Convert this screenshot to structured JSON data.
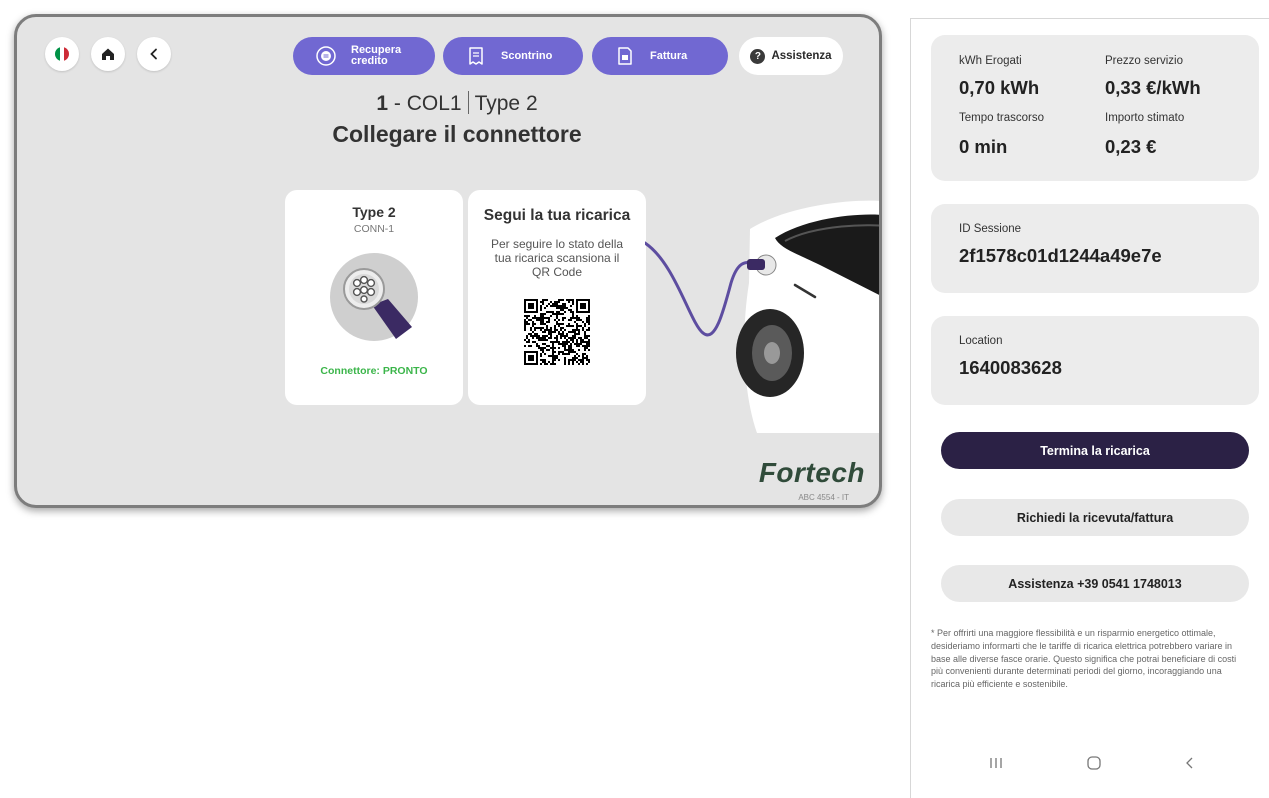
{
  "kiosk": {
    "toolbar": {
      "language_flag_colors": [
        "#009246",
        "#ffffff",
        "#ce2b37"
      ],
      "recover_credit_label": "Recupera\ncredito",
      "receipt_label": "Scontrino",
      "invoice_label": "Fattura",
      "help_label": "Assistenza",
      "help_glyph": "?",
      "accent_color": "#7168d2"
    },
    "station": {
      "number": "1",
      "name_prefix": " - COL1",
      "connector_type": "Type 2"
    },
    "instruction": "Collegare il connettore",
    "connector_card": {
      "title": "Type 2",
      "code": "CONN-1",
      "status": "Connettore: PRONTO",
      "status_color": "#3bb54a"
    },
    "qr_card": {
      "title": "Segui la tua ricarica",
      "text": "Per seguire lo stato della tua ricarica scansiona il QR Code"
    },
    "brand": "Fortech",
    "serial": "ABC 4554 - IT"
  },
  "phone": {
    "stats": {
      "kwh_label": "kWh Erogati",
      "kwh_value": "0,70 kWh",
      "price_label": "Prezzo servizio",
      "price_value": "0,33 €/kWh",
      "time_label": "Tempo trascorso",
      "time_value": "0 min",
      "amount_label": "Importo stimato",
      "amount_value": "0,23 €"
    },
    "session": {
      "label": "ID Sessione",
      "value": "2f1578c01d1244a49e7e"
    },
    "location": {
      "label": "Location",
      "value": "1640083628"
    },
    "buttons": {
      "end": "Termina la ricarica",
      "receipt": "Richiedi la ricevuta/fattura",
      "support": "Assistenza +39 0541 1748013"
    },
    "disclaimer": "* Per offrirti una maggiore flessibilità e un risparmio energetico ottimale, desideriamo informarti che le tariffe di ricarica elettrica potrebbero variare in base alle diverse fasce orarie. Questo significa che potrai beneficiare di costi più convenienti durante determinati periodi del giorno, incoraggiando una ricarica più efficiente e sostenibile.",
    "navbar": [
      "recent-apps-icon",
      "home-icon",
      "back-icon"
    ],
    "end_button_color": "#2b2145"
  }
}
